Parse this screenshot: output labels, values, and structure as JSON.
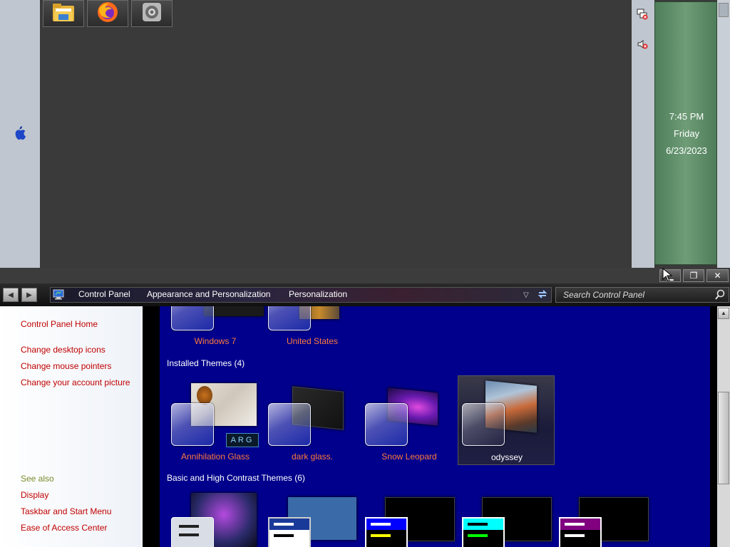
{
  "dock": {
    "items": [
      {
        "name": "file-explorer-icon"
      },
      {
        "name": "firefox-icon"
      },
      {
        "name": "system-settings-icon"
      }
    ]
  },
  "clock": {
    "time": "7:45 PM",
    "day": "Friday",
    "date": "6/23/2023"
  },
  "window_controls": {
    "minimize": "▁",
    "restore": "❐",
    "close": "✕"
  },
  "breadcrumb": {
    "items": [
      "Control Panel",
      "Appearance and Personalization",
      "Personalization"
    ]
  },
  "search": {
    "placeholder": "Search Control Panel"
  },
  "left_pane": {
    "home": "Control Panel Home",
    "tasks": [
      "Change desktop icons",
      "Change mouse pointers",
      "Change your account picture"
    ],
    "see_also_title": "See also",
    "see_also": [
      "Display",
      "Taskbar and Start Menu",
      "Ease of Access Center"
    ]
  },
  "content": {
    "top_row": [
      "Windows 7",
      "United States"
    ],
    "installed_title": "Installed Themes (4)",
    "installed": [
      "Annihilation Glass",
      "dark glass.",
      "Snow Leopard",
      "odyssey"
    ],
    "basic_title": "Basic and High Contrast Themes (6)",
    "arg_badge": "ARG"
  },
  "colors": {
    "content_bg": "#00008c",
    "theme_label": "#ff7a3a",
    "task_link": "#c00000",
    "clock_panel": "#5f8f69"
  }
}
